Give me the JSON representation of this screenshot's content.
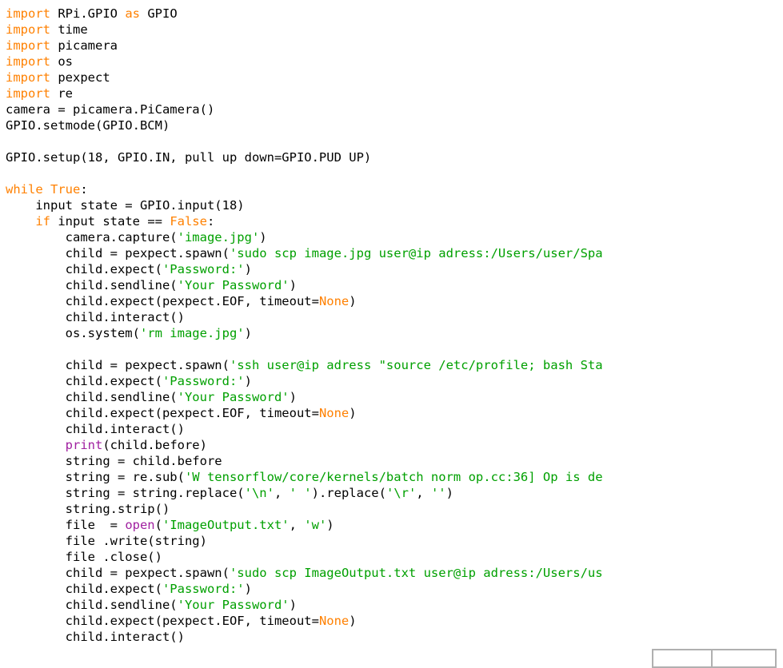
{
  "editor": {
    "background_color": "#ffffff",
    "default_text_color": "#000000",
    "keyword_color": "#ff8000",
    "string_color": "#00a000",
    "builtin_color": "#a020a0",
    "font_size_px": 15.5,
    "line_height_px": 20
  },
  "bottom_bar": {
    "left_cell_label": "",
    "right_cell_label": "",
    "border_color": "#b0b0b0"
  },
  "code": {
    "language": "python",
    "lines": [
      [
        {
          "t": "import",
          "c": "kw"
        },
        {
          "t": " RPi.GPIO ",
          "c": "plain"
        },
        {
          "t": "as",
          "c": "kw"
        },
        {
          "t": " GPIO",
          "c": "plain"
        }
      ],
      [
        {
          "t": "import",
          "c": "kw"
        },
        {
          "t": " time",
          "c": "plain"
        }
      ],
      [
        {
          "t": "import",
          "c": "kw"
        },
        {
          "t": " picamera",
          "c": "plain"
        }
      ],
      [
        {
          "t": "import",
          "c": "kw"
        },
        {
          "t": " os",
          "c": "plain"
        }
      ],
      [
        {
          "t": "import",
          "c": "kw"
        },
        {
          "t": " pexpect",
          "c": "plain"
        }
      ],
      [
        {
          "t": "import",
          "c": "kw"
        },
        {
          "t": " re",
          "c": "plain"
        }
      ],
      [
        {
          "t": "camera = picamera.PiCamera()",
          "c": "plain"
        }
      ],
      [
        {
          "t": "GPIO.setmode(GPIO.BCM)",
          "c": "plain"
        }
      ],
      [
        {
          "t": "",
          "c": "plain"
        }
      ],
      [
        {
          "t": "GPIO.setup(18, GPIO.IN, pull up down=GPIO.PUD UP)",
          "c": "plain"
        }
      ],
      [
        {
          "t": "",
          "c": "plain"
        }
      ],
      [
        {
          "t": "while",
          "c": "kw"
        },
        {
          "t": " ",
          "c": "plain"
        },
        {
          "t": "True",
          "c": "kw"
        },
        {
          "t": ":",
          "c": "plain"
        }
      ],
      [
        {
          "t": "    input state = GPIO.input(18)",
          "c": "plain"
        }
      ],
      [
        {
          "t": "    ",
          "c": "plain"
        },
        {
          "t": "if",
          "c": "kw"
        },
        {
          "t": " input state == ",
          "c": "plain"
        },
        {
          "t": "False",
          "c": "kw"
        },
        {
          "t": ":",
          "c": "plain"
        }
      ],
      [
        {
          "t": "        camera.capture(",
          "c": "plain"
        },
        {
          "t": "'image.jpg'",
          "c": "str"
        },
        {
          "t": ")",
          "c": "plain"
        }
      ],
      [
        {
          "t": "        child = pexpect.spawn(",
          "c": "plain"
        },
        {
          "t": "'sudo scp image.jpg user@ip adress:/Users/user/Spa",
          "c": "str"
        }
      ],
      [
        {
          "t": "        child.expect(",
          "c": "plain"
        },
        {
          "t": "'Password:'",
          "c": "str"
        },
        {
          "t": ")",
          "c": "plain"
        }
      ],
      [
        {
          "t": "        child.sendline(",
          "c": "plain"
        },
        {
          "t": "'Your Password'",
          "c": "str"
        },
        {
          "t": ")",
          "c": "plain"
        }
      ],
      [
        {
          "t": "        child.expect(pexpect.EOF, timeout=",
          "c": "plain"
        },
        {
          "t": "None",
          "c": "kw"
        },
        {
          "t": ")",
          "c": "plain"
        }
      ],
      [
        {
          "t": "        child.interact()",
          "c": "plain"
        }
      ],
      [
        {
          "t": "        os.system(",
          "c": "plain"
        },
        {
          "t": "'rm image.jpg'",
          "c": "str"
        },
        {
          "t": ")",
          "c": "plain"
        }
      ],
      [
        {
          "t": "",
          "c": "plain"
        }
      ],
      [
        {
          "t": "        child = pexpect.spawn(",
          "c": "plain"
        },
        {
          "t": "'ssh user@ip adress \"source /etc/profile; bash Sta",
          "c": "str"
        }
      ],
      [
        {
          "t": "        child.expect(",
          "c": "plain"
        },
        {
          "t": "'Password:'",
          "c": "str"
        },
        {
          "t": ")",
          "c": "plain"
        }
      ],
      [
        {
          "t": "        child.sendline(",
          "c": "plain"
        },
        {
          "t": "'Your Password'",
          "c": "str"
        },
        {
          "t": ")",
          "c": "plain"
        }
      ],
      [
        {
          "t": "        child.expect(pexpect.EOF, timeout=",
          "c": "plain"
        },
        {
          "t": "None",
          "c": "kw"
        },
        {
          "t": ")",
          "c": "plain"
        }
      ],
      [
        {
          "t": "        child.interact()",
          "c": "plain"
        }
      ],
      [
        {
          "t": "        ",
          "c": "plain"
        },
        {
          "t": "print",
          "c": "builtin"
        },
        {
          "t": "(child.before)",
          "c": "plain"
        }
      ],
      [
        {
          "t": "        string = child.before",
          "c": "plain"
        }
      ],
      [
        {
          "t": "        string = re.sub(",
          "c": "plain"
        },
        {
          "t": "'W tensorflow/core/kernels/batch norm op.cc:36] Op is de",
          "c": "str"
        }
      ],
      [
        {
          "t": "        string = string.replace(",
          "c": "plain"
        },
        {
          "t": "'\\n'",
          "c": "str"
        },
        {
          "t": ", ",
          "c": "plain"
        },
        {
          "t": "' '",
          "c": "str"
        },
        {
          "t": ").replace(",
          "c": "plain"
        },
        {
          "t": "'\\r'",
          "c": "str"
        },
        {
          "t": ", ",
          "c": "plain"
        },
        {
          "t": "''",
          "c": "str"
        },
        {
          "t": ")",
          "c": "plain"
        }
      ],
      [
        {
          "t": "        string.strip()",
          "c": "plain"
        }
      ],
      [
        {
          "t": "        file  = ",
          "c": "plain"
        },
        {
          "t": "open",
          "c": "builtin"
        },
        {
          "t": "(",
          "c": "plain"
        },
        {
          "t": "'ImageOutput.txt'",
          "c": "str"
        },
        {
          "t": ", ",
          "c": "plain"
        },
        {
          "t": "'w'",
          "c": "str"
        },
        {
          "t": ")",
          "c": "plain"
        }
      ],
      [
        {
          "t": "        file .write(string)",
          "c": "plain"
        }
      ],
      [
        {
          "t": "        file .close()",
          "c": "plain"
        }
      ],
      [
        {
          "t": "        child = pexpect.spawn(",
          "c": "plain"
        },
        {
          "t": "'sudo scp ImageOutput.txt user@ip adress:/Users/us",
          "c": "str"
        }
      ],
      [
        {
          "t": "        child.expect(",
          "c": "plain"
        },
        {
          "t": "'Password:'",
          "c": "str"
        },
        {
          "t": ")",
          "c": "plain"
        }
      ],
      [
        {
          "t": "        child.sendline(",
          "c": "plain"
        },
        {
          "t": "'Your Password'",
          "c": "str"
        },
        {
          "t": ")",
          "c": "plain"
        }
      ],
      [
        {
          "t": "        child.expect(pexpect.EOF, timeout=",
          "c": "plain"
        },
        {
          "t": "None",
          "c": "kw"
        },
        {
          "t": ")",
          "c": "plain"
        }
      ],
      [
        {
          "t": "        child.interact()",
          "c": "plain"
        }
      ]
    ]
  }
}
